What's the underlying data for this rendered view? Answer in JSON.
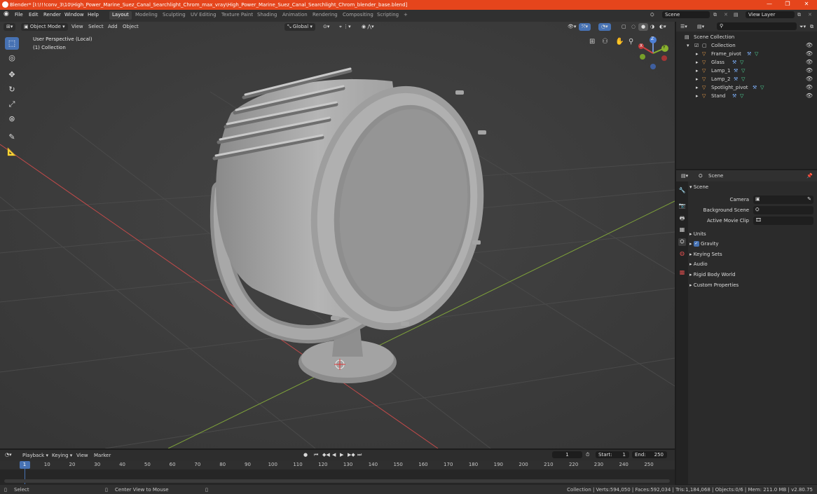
{
  "window": {
    "title": "Blender* [I:\\!!!conv_3\\10\\High_Power_Marine_Suez_Canal_Searchlight_Chrom_max_vray\\High_Power_Marine_Suez_Canal_Searchlight_Chrom_blender_base.blend]",
    "minimize": "—",
    "maximize": "❐",
    "close": "✕"
  },
  "menu": [
    "File",
    "Edit",
    "Render",
    "Window",
    "Help"
  ],
  "workspaces": [
    "Layout",
    "Modeling",
    "Sculpting",
    "UV Editing",
    "Texture Paint",
    "Shading",
    "Animation",
    "Rendering",
    "Compositing",
    "Scripting"
  ],
  "add_tab": "+",
  "scene_field": "Scene",
  "view_layer_field": "View Layer",
  "viewport": {
    "mode": "Object Mode",
    "menus": [
      "View",
      "Select",
      "Add",
      "Object"
    ],
    "orientation": "Global",
    "overlay_line1": "User Perspective (Local)",
    "overlay_line2": "(1) Collection",
    "gizmo_labels": {
      "z": "Z",
      "y": "Y",
      "x": "X"
    }
  },
  "outliner": {
    "root": "Scene Collection",
    "collection": "Collection",
    "items": [
      {
        "name": "Frame_pivot"
      },
      {
        "name": "Glass"
      },
      {
        "name": "Lamp_1"
      },
      {
        "name": "Lamp_2"
      },
      {
        "name": "Spotlight_pivot"
      },
      {
        "name": "Stand"
      }
    ],
    "eye_icon": "👁"
  },
  "properties": {
    "header": "Scene",
    "section": "Scene",
    "camera_label": "Camera",
    "background_scene_label": "Background Scene",
    "active_clip_label": "Active Movie Clip",
    "panels": [
      "Units",
      "Gravity",
      "Keying Sets",
      "Audio",
      "Rigid Body World",
      "Custom Properties"
    ],
    "gravity_checked": true
  },
  "timeline": {
    "menus": [
      "Playback",
      "Keying",
      "View",
      "Marker"
    ],
    "current_frame": "1",
    "start_label": "Start:",
    "start": "1",
    "end_label": "End:",
    "end": "250",
    "ticks": [
      "1",
      "10",
      "20",
      "30",
      "40",
      "50",
      "60",
      "70",
      "80",
      "90",
      "100",
      "110",
      "120",
      "130",
      "140",
      "150",
      "160",
      "170",
      "180",
      "190",
      "200",
      "210",
      "220",
      "230",
      "240",
      "250"
    ]
  },
  "status": {
    "left": "Select",
    "middle": "Center View to Mouse",
    "right": "Collection | Verts:594,050 | Faces:592,034 | Tris:1,184,068 | Objects:0/6 | Mem: 211.0 MB | v2.80.75"
  },
  "colors": {
    "accent": "#4772b3",
    "titlebar": "#e5451c",
    "object_orange": "#f0a14a",
    "x_axis": "#c44a4a",
    "y_axis": "#7fa33a"
  }
}
